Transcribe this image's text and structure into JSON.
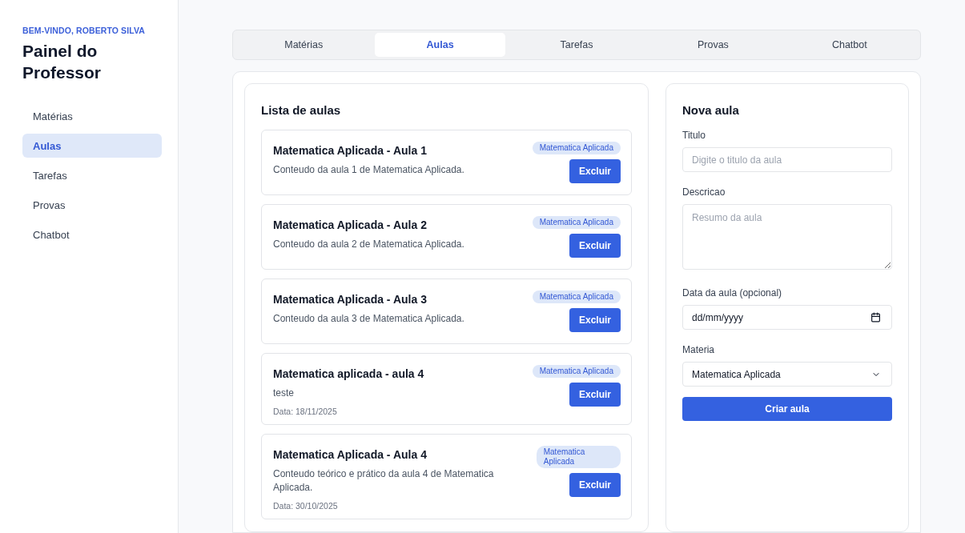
{
  "sidebar": {
    "greeting": "BEM-VINDO, ROBERTO SILVA",
    "title": "Painel do Professor",
    "items": [
      {
        "label": "Matérias",
        "selected": false
      },
      {
        "label": "Aulas",
        "selected": true
      },
      {
        "label": "Tarefas",
        "selected": false
      },
      {
        "label": "Provas",
        "selected": false
      },
      {
        "label": "Chatbot",
        "selected": false
      }
    ]
  },
  "tabs": [
    {
      "label": "Matérias",
      "selected": false
    },
    {
      "label": "Aulas",
      "selected": true
    },
    {
      "label": "Tarefas",
      "selected": false
    },
    {
      "label": "Provas",
      "selected": false
    },
    {
      "label": "Chatbot",
      "selected": false
    }
  ],
  "lesson_list": {
    "title": "Lista de aulas",
    "items": [
      {
        "title": "Matematica Aplicada - Aula 1",
        "description": "Conteudo da aula 1 de Matematica Aplicada.",
        "subject": "Matematica Aplicada",
        "button": "Excluir"
      },
      {
        "title": "Matematica Aplicada - Aula 2",
        "description": "Conteudo da aula 2 de Matematica Aplicada.",
        "subject": "Matematica Aplicada",
        "button": "Excluir"
      },
      {
        "title": "Matematica Aplicada - Aula 3",
        "description": "Conteudo da aula 3 de Matematica Aplicada.",
        "subject": "Matematica Aplicada",
        "button": "Excluir"
      },
      {
        "title": "Matematica aplicada - aula 4",
        "description": "teste",
        "date": "Data: 18/11/2025",
        "subject": "Matematica Aplicada",
        "button": "Excluir"
      },
      {
        "title": "Matematica Aplicada - Aula 4",
        "description": "Conteudo teórico e prático da aula 4 de Matematica Aplicada.",
        "date": "Data: 30/10/2025",
        "subject": "Matematica Aplicada",
        "button": "Excluir"
      }
    ]
  },
  "new_lesson_form": {
    "title": "Nova aula",
    "title_field": {
      "label": "Titulo",
      "placeholder": "Digite o titulo da aula"
    },
    "description_field": {
      "label": "Descricao",
      "placeholder": "Resumo da aula"
    },
    "date_field": {
      "label": "Data da aula (opcional)",
      "placeholder": "dd/mm/yyyy"
    },
    "subject_field": {
      "label": "Materia",
      "value": "Matematica Aplicada"
    },
    "submit_button": "Criar aula"
  }
}
